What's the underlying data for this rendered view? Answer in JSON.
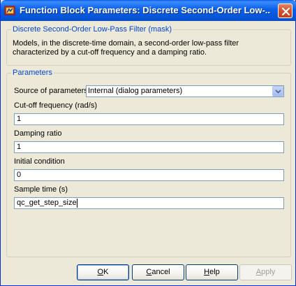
{
  "window": {
    "title": "Function Block Parameters: Discrete Second-Order Low-..."
  },
  "mask": {
    "legend": "Discrete Second-Order Low-Pass Filter (mask)",
    "description": "Models, in the discrete-time domain, a second-order low-pass filter characterized by a cut-off frequency and a damping ratio."
  },
  "parameters": {
    "legend": "Parameters",
    "source_label": "Source of parameters",
    "source_value": "Internal (dialog parameters)",
    "cutoff_label": "Cut-off frequency (rad/s)",
    "cutoff_value": "1",
    "damping_label": "Damping ratio",
    "damping_value": "1",
    "initial_label": "Initial condition",
    "initial_value": "0",
    "sample_label": "Sample time (s)",
    "sample_value": "qc_get_step_size"
  },
  "buttons": {
    "ok_mnemonic": "O",
    "ok_rest": "K",
    "cancel_mnemonic": "C",
    "cancel_rest": "ancel",
    "help_mnemonic": "H",
    "help_rest": "elp",
    "apply_mnemonic": "A",
    "apply_rest": "pply"
  },
  "colors": {
    "titlebar": "#0a5fe8",
    "legend_text": "#0046d5",
    "dialog_bg": "#ece9d8",
    "close_button": "#d8532f"
  },
  "icons": {
    "app": "simulink-block-icon",
    "close": "close-icon",
    "dropdown": "chevron-down-icon"
  }
}
